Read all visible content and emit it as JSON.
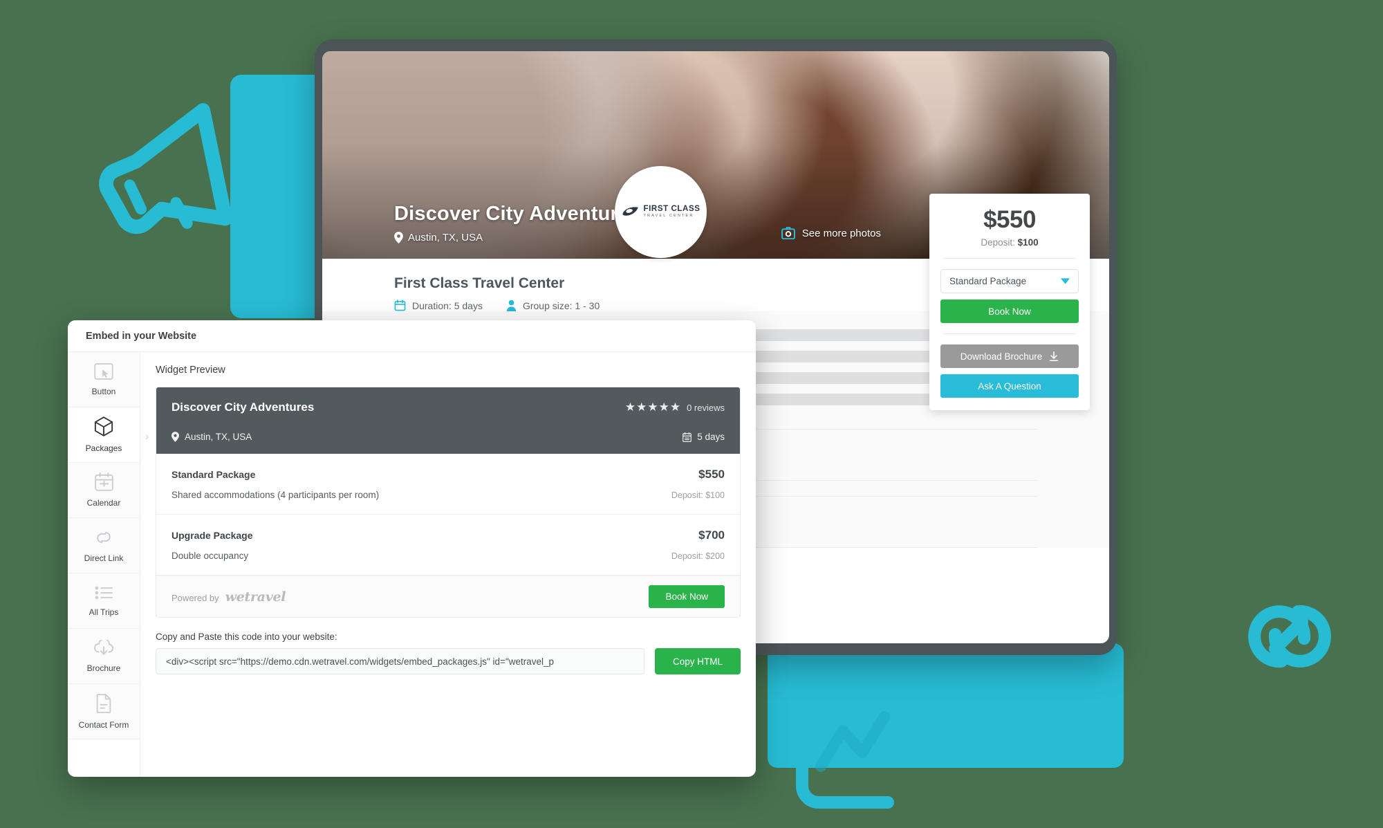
{
  "theme": {
    "background": "#48714f",
    "teal": "#27bcd4",
    "green": "#2ab34a",
    "cyan": "#28bcd8",
    "dark_slate": "#525a5d",
    "grey_button": "#9a9a9a"
  },
  "hero": {
    "title": "Discover City Adventures",
    "location": "Austin, TX, USA",
    "see_more_photos": "See more photos",
    "location_icon": "map-pin-icon",
    "camera_icon": "camera-icon"
  },
  "logo": {
    "line1": "FIRST CLASS",
    "line2": "TRAVEL CENTER"
  },
  "trip_info": {
    "operator": "First Class Travel Center",
    "duration": "Duration: 5 days",
    "group_size": "Group size: 1 - 30",
    "duration_icon": "calendar-icon",
    "group_icon": "person-icon"
  },
  "booking_panel": {
    "price": "$550",
    "deposit_label": "Deposit:",
    "deposit_value": "$100",
    "package_selected": "Standard Package",
    "package_options": [
      "Standard Package",
      "Upgrade Package"
    ],
    "book_now": "Book Now",
    "download_brochure": "Download Brochure",
    "ask_a_question": "Ask A Question",
    "chevron_icon": "chevron-down-icon",
    "download_icon": "download-icon"
  },
  "embed_modal": {
    "title": "Embed in your Website",
    "sidebar": [
      {
        "label": "Button",
        "icon": "cursor-click-icon",
        "active": false
      },
      {
        "label": "Packages",
        "icon": "cube-icon",
        "active": true
      },
      {
        "label": "Calendar",
        "icon": "calendar-icon",
        "active": false
      },
      {
        "label": "Direct Link",
        "icon": "link-icon",
        "active": false
      },
      {
        "label": "All Trips",
        "icon": "list-icon",
        "active": false
      },
      {
        "label": "Brochure",
        "icon": "cloud-download-icon",
        "active": false
      },
      {
        "label": "Contact Form",
        "icon": "document-icon",
        "active": false
      }
    ],
    "preview_label": "Widget Preview",
    "widget": {
      "trip_title": "Discover City Adventures",
      "stars": "★★★★★",
      "reviews": "0 reviews",
      "location": "Austin, TX, USA",
      "duration": "5 days",
      "location_icon": "map-pin-icon",
      "duration_icon": "calendar-icon",
      "packages": [
        {
          "name": "Standard Package",
          "price": "$550",
          "description": "Shared accommodations (4 participants per room)",
          "deposit": "Deposit: $100"
        },
        {
          "name": "Upgrade Package",
          "price": "$700",
          "description": "Double occupancy",
          "deposit": "Deposit: $200"
        }
      ],
      "powered_by": "Powered by",
      "brand": "wetravel",
      "book_now": "Book Now"
    },
    "code_label": "Copy and Paste this code into your website:",
    "code_value": "<div><script src=\"https://demo.cdn.wetravel.com/widgets/embed_packages.js\" id=\"wetravel_p",
    "copy_button": "Copy HTML"
  },
  "decorations": {
    "megaphone": "megaphone-icon",
    "link": "link-icon",
    "chart_line": "chart-line-icon"
  }
}
